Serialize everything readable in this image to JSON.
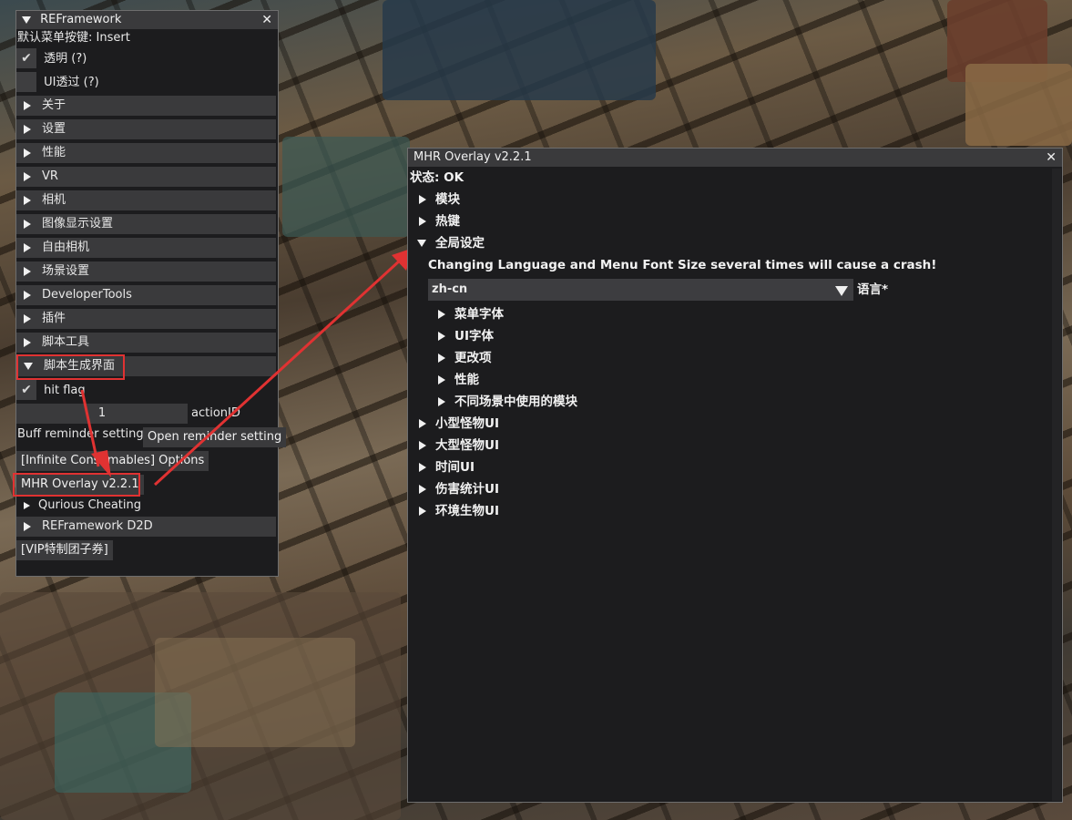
{
  "left_window": {
    "title": "REFramework",
    "default_menu_key_label": "默认菜单按键: Insert",
    "transparent_label": "透明 (?)",
    "ui_passthrough_label": "UI透过 (?)",
    "sections": [
      "关于",
      "设置",
      "性能",
      "VR",
      "相机",
      "图像显示设置",
      "自由相机",
      "场景设置",
      "DeveloperTools",
      "插件",
      "脚本工具"
    ],
    "script_ui_section": "脚本生成界面",
    "hit_flag_label": "hit flag",
    "action_id_value": "1",
    "action_id_label": "actionID",
    "buff_reminder_label": "Buff reminder setting",
    "open_reminder_button": "Open reminder setting",
    "infinite_consumables_button": "[Infinite Consumables] Options",
    "mhr_overlay_button": "MHR Overlay v2.2.1",
    "qurious_cheating": "Qurious Cheating",
    "d2d_section": "REFramework D2D",
    "vip_button": "[VIP特制团子券]"
  },
  "mhr_window": {
    "title": "MHR Overlay v2.2.1",
    "status": "状态: OK",
    "modules": "模块",
    "hotkeys": "热键",
    "global_settings": "全局设定",
    "warning": "Changing Language and Menu Font Size several times will cause a crash!",
    "language_value": "zh-cn",
    "language_label": "语言*",
    "sub_items": [
      "菜单字体",
      "UI字体",
      "更改项",
      "性能",
      "不同场景中使用的模块"
    ],
    "sections": [
      "小型怪物UI",
      "大型怪物UI",
      "时间UI",
      "伤害统计UI",
      "环境生物UI"
    ]
  },
  "colors": {
    "highlight_box": "#e03232",
    "window_bg": "#1c1c1e",
    "header_bg": "#3a3a3c"
  },
  "icons": [
    "close-icon",
    "expand-arrow-icon",
    "collapse-arrow-icon",
    "check-icon",
    "dropdown-arrow-icon"
  ]
}
